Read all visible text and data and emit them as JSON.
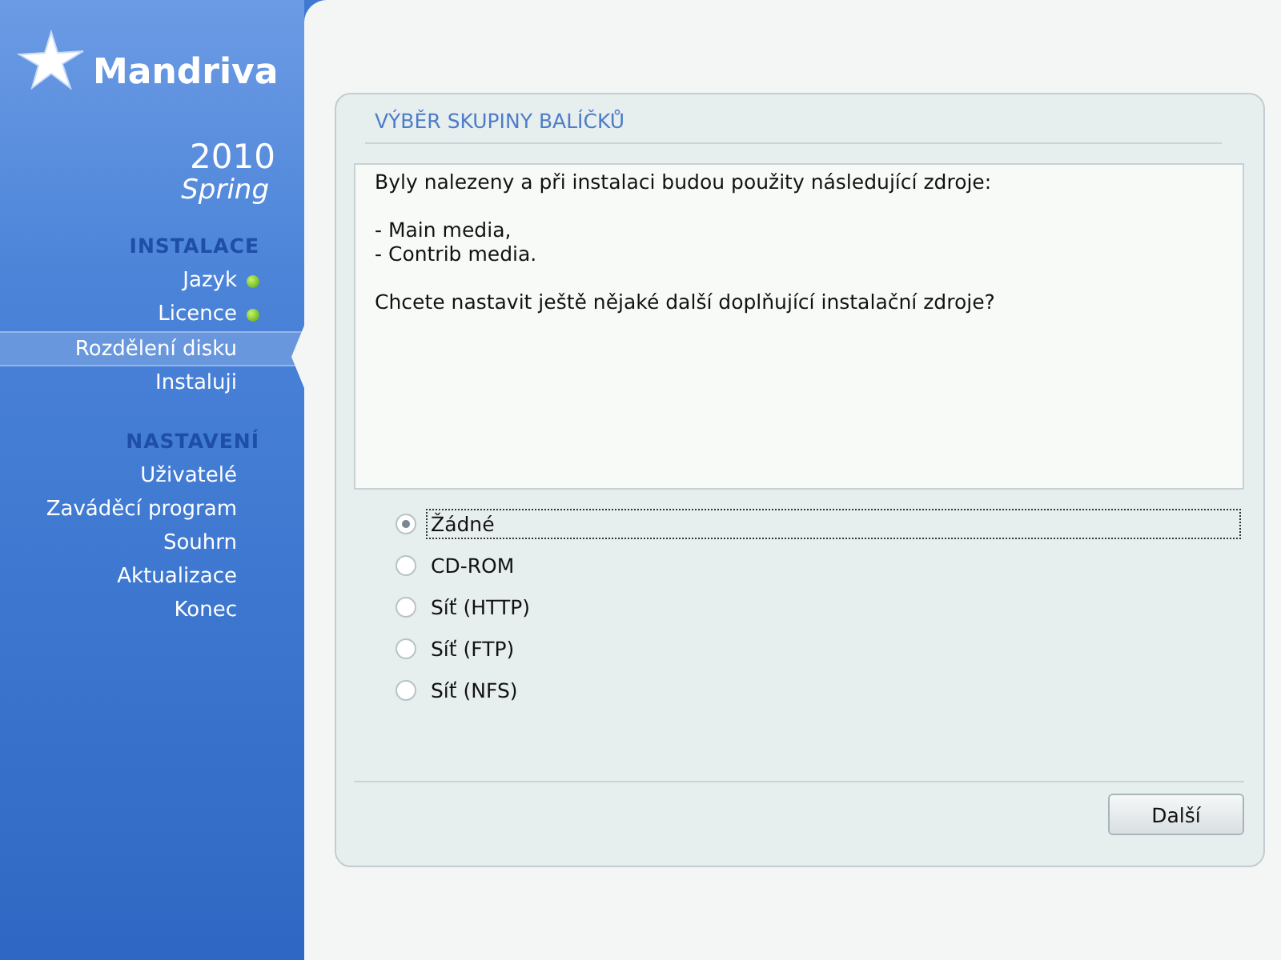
{
  "logo": {
    "name": "Mandriva",
    "version": "2010",
    "edition": "Spring"
  },
  "sidebar": {
    "sections": [
      {
        "title": "INSTALACE",
        "items": [
          {
            "label": "Jazyk",
            "done": true,
            "selected": false
          },
          {
            "label": "Licence",
            "done": true,
            "selected": false
          },
          {
            "label": "Rozdělení disku",
            "done": false,
            "selected": true
          },
          {
            "label": "Instaluji",
            "done": false,
            "selected": false
          }
        ]
      },
      {
        "title": "NASTAVENÍ",
        "items": [
          {
            "label": "Uživatelé",
            "done": false,
            "selected": false
          },
          {
            "label": "Zaváděcí program",
            "done": false,
            "selected": false
          },
          {
            "label": "Souhrn",
            "done": false,
            "selected": false
          },
          {
            "label": "Aktualizace",
            "done": false,
            "selected": false
          },
          {
            "label": "Konec",
            "done": false,
            "selected": false
          }
        ]
      }
    ]
  },
  "panel": {
    "title": "VÝBĚR SKUPINY BALÍČKŮ",
    "message": [
      [
        "Byly nalezeny a při instalaci budou použity následující zdroje:"
      ],
      [
        "- Main media,",
        "- Contrib media."
      ],
      [
        "Chcete nastavit ještě nějaké další doplňující instalační zdroje?"
      ]
    ],
    "options": [
      {
        "label": "Žádné",
        "selected": true
      },
      {
        "label": "CD-ROM",
        "selected": false
      },
      {
        "label": "Síť (HTTP)",
        "selected": false
      },
      {
        "label": "Síť (FTP)",
        "selected": false
      },
      {
        "label": "Síť (NFS)",
        "selected": false
      }
    ],
    "buttons": [
      "Další"
    ]
  }
}
